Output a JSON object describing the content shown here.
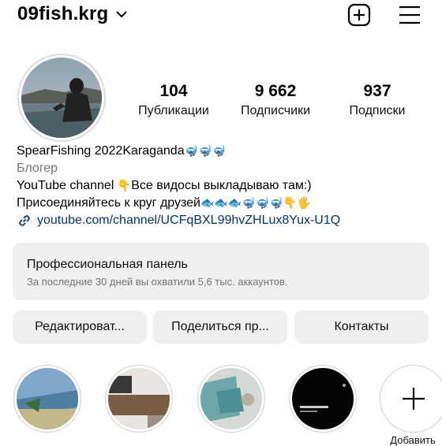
{
  "header": {
    "username": "09fish.krg",
    "icons": [
      "chevron-down-icon",
      "add-post-icon",
      "menu-icon"
    ]
  },
  "stats": [
    {
      "value": "104",
      "label": "Публикации"
    },
    {
      "value": "9 662",
      "label": "Подписчики"
    },
    {
      "value": "937",
      "label": "Подписки"
    }
  ],
  "bio": {
    "name": "SpearFishing 2022Karaganda",
    "name_emoji": "🤿🤿🤿",
    "category": "Блогер",
    "line1": "YouTube channel ",
    "line1_emoji": "👇",
    "line1_rest": "Все видосы выкладываю там:)",
    "line2": "Присоединяйтесь к круг друзей",
    "line2_emoji": "🐟🐟🐟🤿🤿🤿👇🖐",
    "link": "youtube.com/channel/UCFqBXL99hvZHLux8Yux-U1Q"
  },
  "pro_panel": {
    "title": "Профессиональная панель",
    "subtitle": "За последние 30 дней вы охватили 5,6 тыс. аккаунтов."
  },
  "buttons": {
    "edit": "Редактироват...",
    "share": "Поделиться пр...",
    "contacts": "Контакты"
  },
  "highlights": {
    "new_label": "Добавить"
  },
  "colors": {
    "link": "#00376b",
    "muted": "#737373",
    "panel_bg": "#efefef"
  }
}
